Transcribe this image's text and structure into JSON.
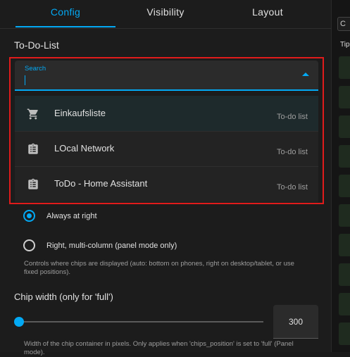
{
  "tabs": [
    {
      "label": "Config",
      "active": true
    },
    {
      "label": "Visibility",
      "active": false
    },
    {
      "label": "Layout",
      "active": false
    }
  ],
  "todo_section": {
    "title": "To-Do-List"
  },
  "search": {
    "label": "Search",
    "value": "",
    "expanded": true
  },
  "menu_items": [
    {
      "label": "Einkaufsliste",
      "type": "To-do list",
      "icon": "cart-icon"
    },
    {
      "label": "LOcal Network",
      "type": "To-do list",
      "icon": "clipboard-list-icon"
    },
    {
      "label": "ToDo - Home Assistant",
      "type": "To-do list",
      "icon": "clipboard-list-icon"
    }
  ],
  "chips_position": {
    "options": [
      {
        "label": "Always at right",
        "checked": true
      },
      {
        "label": "Right, multi-column (panel mode only)",
        "checked": false
      }
    ],
    "helper": "Controls where chips are displayed (auto: bottom on phones, right on desktop/tablet, or use fixed positions)."
  },
  "chip_width": {
    "title": "Chip width (only for 'full')",
    "value": "300",
    "slider_fraction": 0.0,
    "helper": "Width of the chip container in pixels. Only applies when 'chips_position' is set to 'full' (Panel mode)."
  },
  "right_panel": {
    "input_value": "C",
    "label": "Tip"
  },
  "colors": {
    "accent": "#03a9f4",
    "highlight_border": "#e01b1b",
    "background": "#1c1c1c"
  }
}
